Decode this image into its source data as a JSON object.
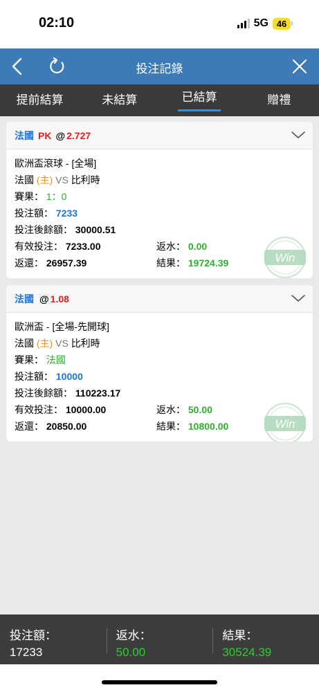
{
  "status": {
    "time": "02:10",
    "network": "5G",
    "battery": "46"
  },
  "header": {
    "title": "投注記錄"
  },
  "tabs": [
    {
      "label": "提前結算"
    },
    {
      "label": "未結算"
    },
    {
      "label": "已結算"
    },
    {
      "label": "贈禮"
    }
  ],
  "bets": [
    {
      "team": "法國",
      "pk": "PK",
      "at": "@",
      "odds": "2.727",
      "league": "歐洲盃滾球 - [全場]",
      "home": "法國",
      "home_tag": "(主)",
      "vs": "VS",
      "away": "比利時",
      "result_label": "賽果：",
      "result_value": "1：0",
      "stake_label": "投注額：",
      "stake_value": "7233",
      "balance_label": "投注後餘額：",
      "balance_value": "30000.51",
      "valid_label": "有效投注：",
      "valid_value": "7233.00",
      "rebate_label": "返水：",
      "rebate_value": "0.00",
      "return_label": "返還：",
      "return_value": "26957.39",
      "outcome_label": "結果：",
      "outcome_value": "19724.39",
      "stamp": "Win"
    },
    {
      "team": "法國",
      "pk": "",
      "at": "@",
      "odds": "1.08",
      "league": "歐洲盃 - [全場-先開球]",
      "home": "法國",
      "home_tag": "(主)",
      "vs": "VS",
      "away": "比利時",
      "result_label": "賽果：",
      "result_value": "法國",
      "stake_label": "投注額：",
      "stake_value": "10000",
      "balance_label": "投注後餘額：",
      "balance_value": "110223.17",
      "valid_label": "有效投注：",
      "valid_value": "10000.00",
      "rebate_label": "返水：",
      "rebate_value": "50.00",
      "return_label": "返還：",
      "return_value": "20850.00",
      "outcome_label": "結果：",
      "outcome_value": "10800.00",
      "stamp": "Win"
    }
  ],
  "footer": {
    "stake_label": "投注額：",
    "stake_value": "17233",
    "rebate_label": "返水：",
    "rebate_value": "50.00",
    "outcome_label": "結果：",
    "outcome_value": "30524.39"
  },
  "colors": {
    "header_bg": "#3d7ab8",
    "tab_bg": "#3a3a3a",
    "tab_indicator": "#2f8fe0",
    "team_blue": "#1e74d8",
    "odds_red": "#e0201b",
    "value_green": "#2dae2d",
    "home_tag_orange": "#e8932b",
    "battery_yellow": "#f5dc2a"
  },
  "icons": [
    "back-arrow-icon",
    "refresh-icon",
    "close-icon",
    "chevron-down-icon",
    "win-stamp-icon",
    "signal-icon",
    "battery-icon"
  ]
}
